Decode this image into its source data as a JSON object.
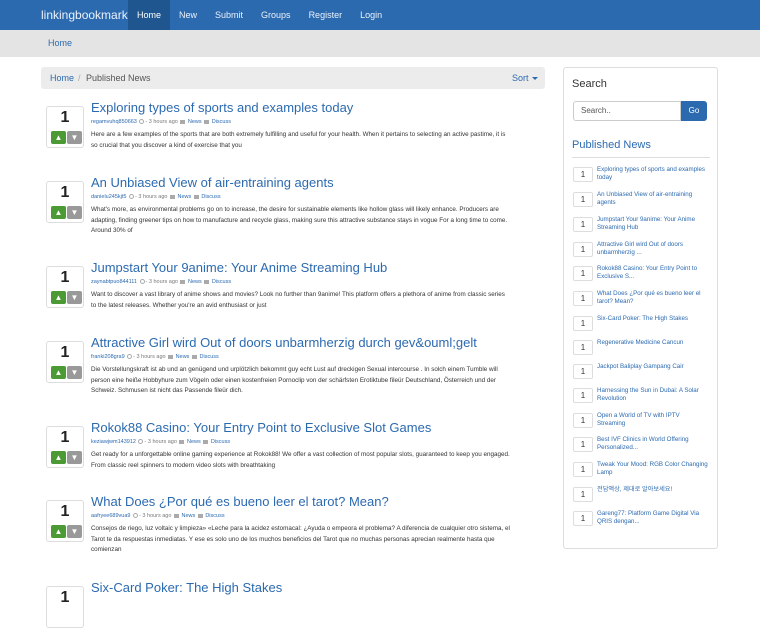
{
  "brand": "linkingbookmark",
  "nav": [
    {
      "label": "Home",
      "active": true
    },
    {
      "label": "New"
    },
    {
      "label": "Submit"
    },
    {
      "label": "Groups"
    },
    {
      "label": "Register"
    },
    {
      "label": "Login"
    }
  ],
  "subbar": {
    "home_label": "Home"
  },
  "breadcrumb": {
    "home": "Home",
    "separator": "/",
    "current": "Published News",
    "sort_label": "Sort"
  },
  "posts": [
    {
      "votes": "1",
      "title": "Exploring types of sports and examples today",
      "author": "regamvuhq850663",
      "time": "3 hours ago",
      "category": "News",
      "discuss": "Discuss",
      "summary": "Here are a few examples of the sports that are both extremely fulfilling and useful for your health. When it pertains to selecting an active pastime, it is so crucial that you discover a kind of exercise that you"
    },
    {
      "votes": "1",
      "title": "An Unbiased View of air-entraining agents",
      "author": "danielu245kjt5",
      "time": "3 hours ago",
      "category": "News",
      "discuss": "Discuss",
      "summary": "What's more, as environmental problems go on to increase, the desire for sustainable elements like hollow glass will likely enhance. Producers are adapting, finding greener tips on how to manufacture and recycle glass, making sure this attractive substance stays in vogue For a long time to come. Around 30% of"
    },
    {
      "votes": "1",
      "title": "Jumpstart Your 9anime: Your Anime Streaming Hub",
      "author": "zaynabtpuo844111",
      "time": "3 hours ago",
      "category": "News",
      "discuss": "Discuss",
      "summary": "Want to discover a vast library of anime shows and movies? Look no further than 9anime! This platform offers a plethora of anime from classic series to the latest releases. Whether you're an avid enthusiast or just"
    },
    {
      "votes": "1",
      "title": "Attractive Girl wird Out of doors unbarmherzig durch gev&ouml;gelt",
      "author": "franki208gra9",
      "time": "3 hours ago",
      "category": "News",
      "discuss": "Discuss",
      "summary": "Die Vorstellungskraft ist ab und an genügend und urplötzlich bekommt guy echt Lust auf dreckigen Sexual intercourse . In solch einem Tumble will person eine heiße Hobbyhure zum Vögeln oder einen kostenfreien Pornoclip von der schärfsten Erotiktube fileür Deutschland, Österreich und der Schweiz. Schmusen ist nicht das Passende fileür dich."
    },
    {
      "votes": "1",
      "title": "Rokok88 Casino: Your Entry Point to Exclusive Slot Games",
      "author": "keziawjwm143912",
      "time": "3 hours ago",
      "category": "News",
      "discuss": "Discuss",
      "summary": "Get ready for a unforgettable online gaming experience at Rokok88! We offer a vast collection of most popular slots, guaranteed to keep you engaged. From classic reel spinners to modern video slots with breathtaking"
    },
    {
      "votes": "1",
      "title": "What Does ¿Por qué es bueno leer el tarot? Mean?",
      "author": "aafryee689vua9",
      "time": "3 hours ago",
      "category": "News",
      "discuss": "Discuss",
      "summary": "Consejos de riego, luz voltaic y limpieza» «Leche para la acidez estomacal: ¿Ayuda o empeora el problema? A diferencia de cualquier otro sistema, el Tarot te da respuestas inmediatas. Y ese es solo uno de los muchos beneficios del Tarot que no muchas personas aprecian realmente hasta que comienzan"
    },
    {
      "votes": "1",
      "title": "Six-Card Poker: The High Stakes",
      "author": "",
      "time": "",
      "category": "",
      "discuss": "",
      "summary": ""
    }
  ],
  "sidebar": {
    "search_heading": "Search",
    "search_placeholder": "Search..",
    "search_button": "Go",
    "published_heading": "Published News",
    "items": [
      {
        "votes": "1",
        "title": "Exploring types of sports and examples today"
      },
      {
        "votes": "1",
        "title": "An Unbiased View of air-entraining agents"
      },
      {
        "votes": "1",
        "title": "Jumpstart Your 9anime: Your Anime Streaming Hub"
      },
      {
        "votes": "1",
        "title": "Attractive Girl wird Out of doors unbarmherzig ..."
      },
      {
        "votes": "1",
        "title": "Rokok88 Casino: Your Entry Point to Exclusive S..."
      },
      {
        "votes": "1",
        "title": "What Does ¿Por qué es bueno leer el tarot? Mean?"
      },
      {
        "votes": "1",
        "title": "Six-Card Poker: The High Stakes"
      },
      {
        "votes": "1",
        "title": "Regenerative Medicine Cancun"
      },
      {
        "votes": "1",
        "title": "Jackpot Baliplay Gampang Cair"
      },
      {
        "votes": "1",
        "title": "Harnessing the Sun in Dubai: A Solar Revolution"
      },
      {
        "votes": "1",
        "title": "Open a World of TV with IPTV Streaming"
      },
      {
        "votes": "1",
        "title": "Best IVF Clinics in World Offering Personalized..."
      },
      {
        "votes": "1",
        "title": "Tweak Your Mood: RGB Color Changing Lamp"
      },
      {
        "votes": "1",
        "title": "전담액상, 제대로 알아보세요!"
      },
      {
        "votes": "1",
        "title": "Gareng77: Platform Game Digital Via QRIS dengan..."
      }
    ]
  },
  "colors": {
    "primary": "#2c6ab0",
    "upvote": "#4b9a34",
    "downvote": "#999999"
  },
  "icons": {
    "up": "thumbs-up-icon",
    "down": "thumbs-down-icon"
  }
}
